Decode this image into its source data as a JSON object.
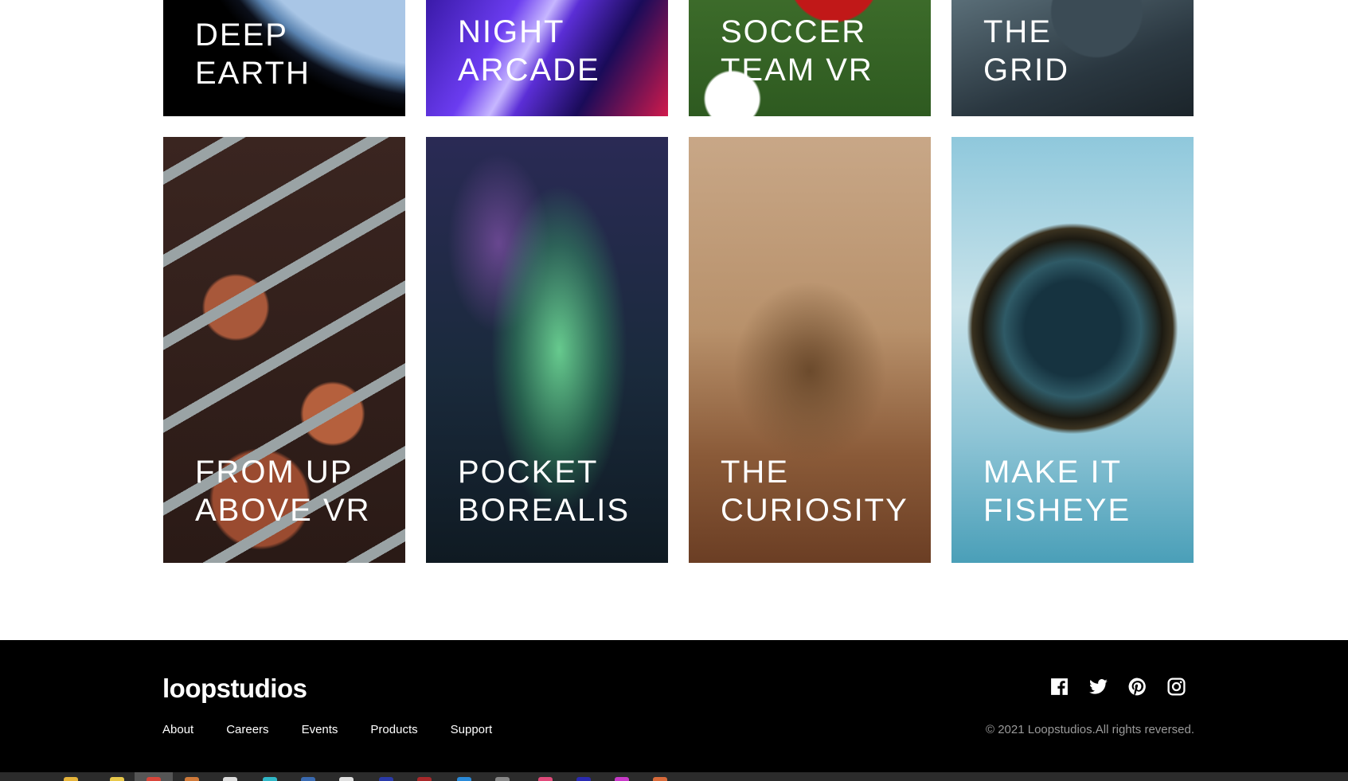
{
  "gallery": {
    "cards": [
      {
        "line1": "DEEP",
        "line2": "EARTH"
      },
      {
        "line1": "NIGHT",
        "line2": "ARCADE"
      },
      {
        "line1": "SOCCER",
        "line2": "TEAM VR"
      },
      {
        "line1": "THE",
        "line2": "GRID"
      },
      {
        "line1": "FROM UP",
        "line2": "ABOVE VR"
      },
      {
        "line1": "POCKET",
        "line2": "BOREALIS"
      },
      {
        "line1": "THE",
        "line2": "CURIOSITY"
      },
      {
        "line1": "MAKE IT",
        "line2": "FISHEYE"
      }
    ]
  },
  "footer": {
    "logo": "loopstudios",
    "nav": [
      "About",
      "Careers",
      "Events",
      "Products",
      "Support"
    ],
    "social_icons": [
      "facebook-icon",
      "twitter-icon",
      "pinterest-icon",
      "instagram-icon"
    ],
    "copyright": "© 2021 Loopstudios.All rights reversed."
  },
  "colors": {
    "footer_bg": "#000000",
    "text_light": "#ffffff",
    "text_muted": "#9a9a9a"
  }
}
